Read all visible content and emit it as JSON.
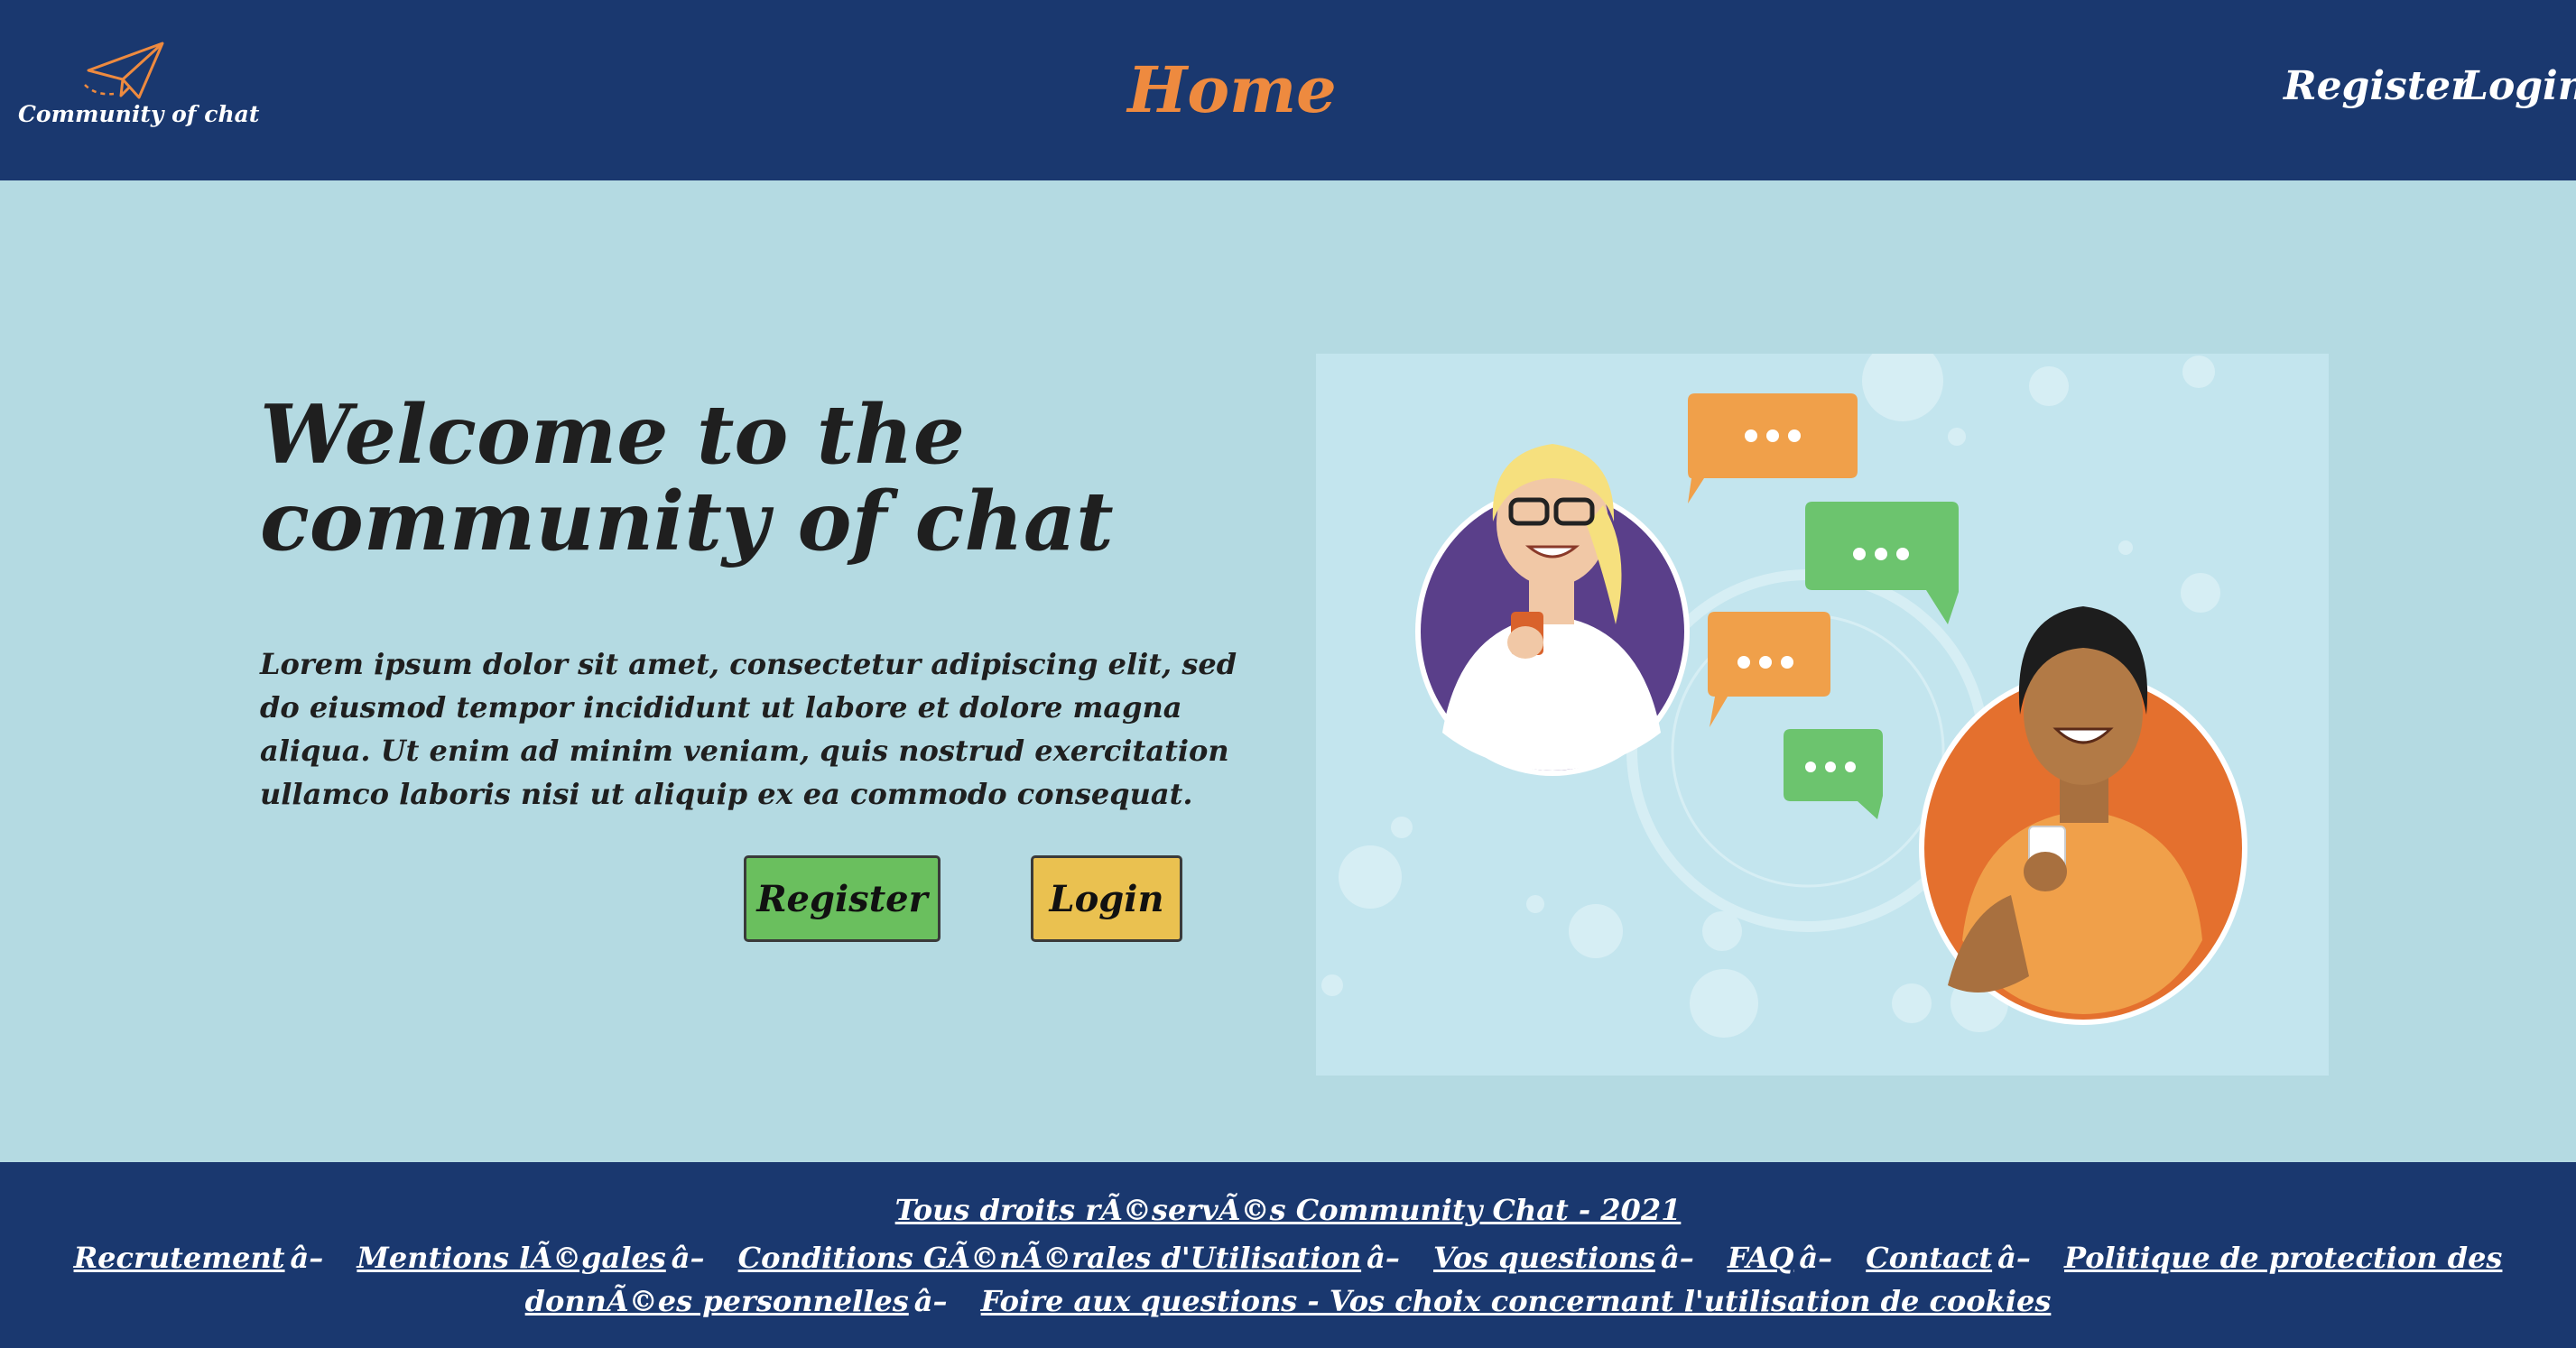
{
  "header": {
    "logo_text": "Community of chat",
    "title": "Home",
    "nav": {
      "register": "Register",
      "login": "Login"
    }
  },
  "main": {
    "heading": "Welcome to the community of chat",
    "paragraph": "Lorem ipsum dolor sit amet, consectetur adipiscing elit, sed do eiusmod tempor incididunt ut labore et dolore magna aliqua. Ut enim ad minim veniam, quis nostrud exercitation ullamco laboris nisi ut aliquip ex ea commodo consequat.",
    "register_button": "Register",
    "login_button": "Login",
    "bubble_text": "•••"
  },
  "footer": {
    "copyright": "Tous droits rÃ©servÃ©s Community Chat - 2021",
    "separator": "â–",
    "links": [
      "Recrutement",
      "Mentions lÃ©gales",
      "Conditions GÃ©nÃ©rales d'Utilisation",
      "Vos questions",
      "FAQ",
      "Contact",
      "Politique de protection des donnÃ©es personnelles",
      "Foire aux questions - Vos choix concernant l'utilisation de cookies"
    ]
  },
  "colors": {
    "header_bg": "#1a386f",
    "page_bg": "#b4dae2",
    "title_orange": "#ee8a3f",
    "register_green": "#6abf5e",
    "login_yellow": "#eac150"
  },
  "icons": {
    "logo": "paper-plane-icon"
  }
}
